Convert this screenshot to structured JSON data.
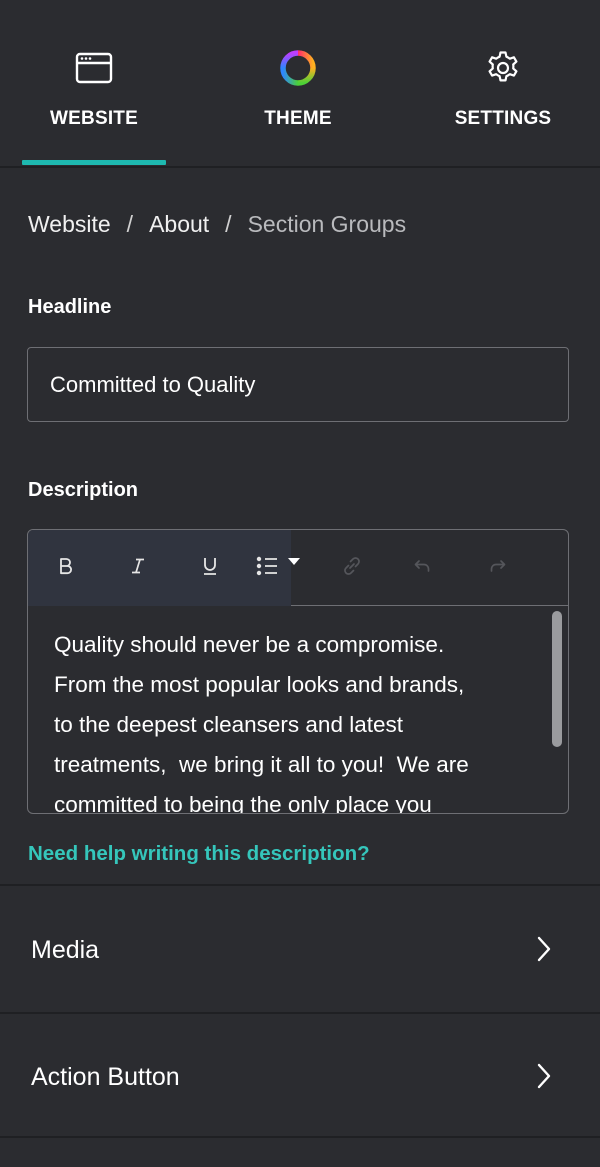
{
  "tabs": [
    {
      "label": "WEBSITE",
      "icon": "browser-window-icon",
      "active": true
    },
    {
      "label": "THEME",
      "icon": "color-wheel-icon",
      "active": false
    },
    {
      "label": "SETTINGS",
      "icon": "gear-icon",
      "active": false
    }
  ],
  "breadcrumb": {
    "items": [
      "Website",
      "About",
      "Section Groups"
    ],
    "separator": "/"
  },
  "headline": {
    "label": "Headline",
    "value": "Committed to Quality"
  },
  "description": {
    "label": "Description",
    "text": "Quality should never be a compromise.\nFrom the most popular looks and brands,\nto the deepest cleansers and latest\ntreatments,  we bring it all to you!  We are\ncommitted to being the only place you",
    "toolbar": [
      "bold-icon",
      "italic-icon",
      "underline-icon",
      "bulleted-list-icon",
      "link-icon",
      "undo-icon",
      "redo-icon"
    ]
  },
  "help_link": "Need help writing this description?",
  "sections": [
    {
      "label": "Media"
    },
    {
      "label": "Action Button"
    }
  ],
  "colors": {
    "background": "#2b2c30",
    "accent": "#1eb9b0",
    "link": "#35c6bb"
  }
}
